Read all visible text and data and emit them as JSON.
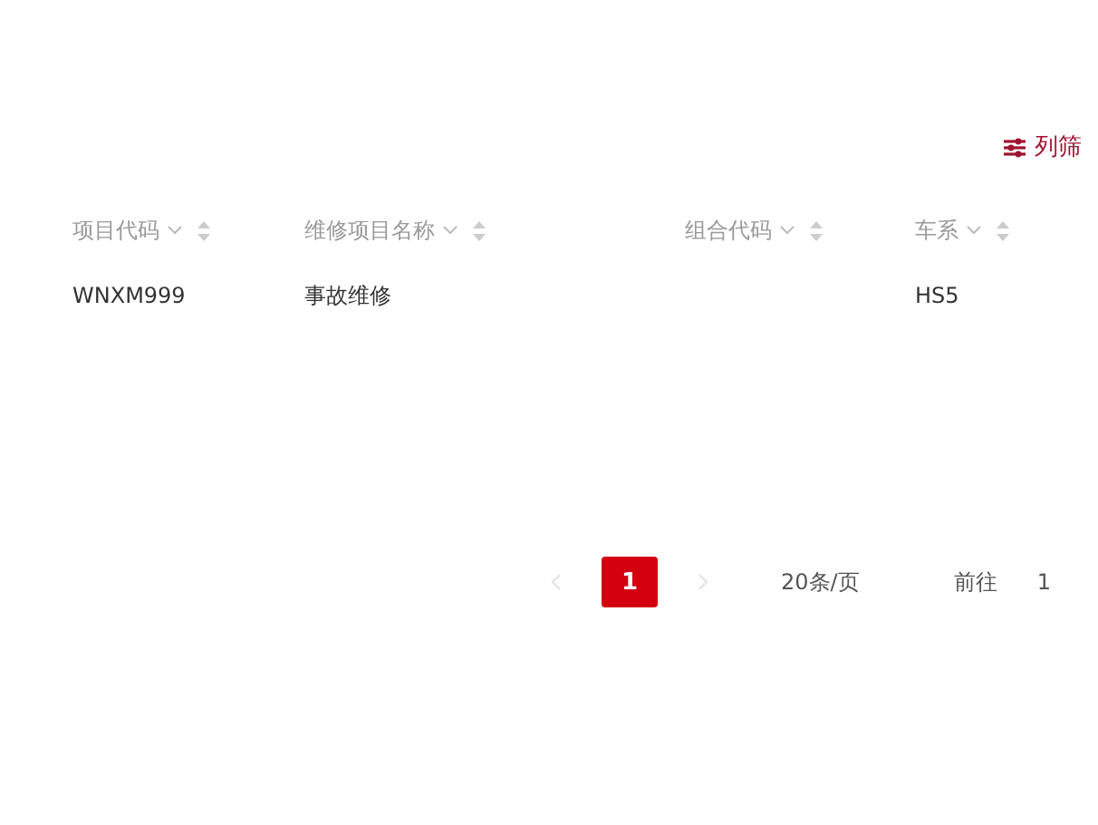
{
  "toolbar": {
    "filter_button": "列筛"
  },
  "table": {
    "columns": [
      {
        "label": "项目代码"
      },
      {
        "label": "维修项目名称"
      },
      {
        "label": "组合代码"
      },
      {
        "label": "车系"
      }
    ],
    "rows": [
      [
        "WNXM999",
        "事故维修",
        "",
        "HS5"
      ]
    ]
  },
  "pagination": {
    "pages": [
      {
        "label": "1",
        "selected": true
      }
    ],
    "prev_disabled": true,
    "next_disabled": true,
    "page_size": "20条/页",
    "goto_label": "前往",
    "goto_value": "1"
  }
}
